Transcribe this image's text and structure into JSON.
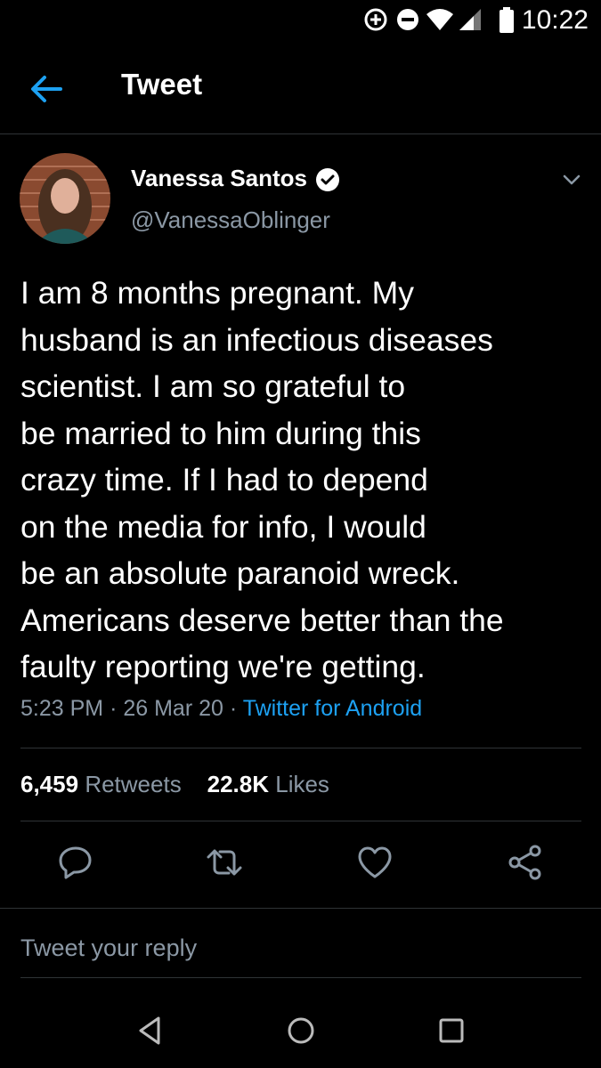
{
  "status_bar": {
    "time": "10:22",
    "icons": [
      "data-saver-icon",
      "do-not-disturb-icon",
      "wifi-icon",
      "signal-icon",
      "battery-icon"
    ]
  },
  "header": {
    "title": "Tweet",
    "back_icon": "arrow-left-icon"
  },
  "tweet": {
    "author_name": "Vanessa Santos",
    "handle": "@VanessaOblinger",
    "verified": true,
    "text": "I am 8 months pregnant. My\nhusband is an infectious diseases\nscientist. I am so grateful to\nbe married to him during this\ncrazy time. If I had to depend\non the media for info, I would\nbe an absolute paranoid wreck.\nAmericans deserve better than the\nfaulty reporting we're getting.",
    "time": "5:23 PM",
    "date": "26 Mar 20",
    "separator": "·",
    "source": "Twitter for Android",
    "retweets_count": "6,459",
    "retweets_label": "Retweets",
    "likes_count": "22.8K",
    "likes_label": "Likes"
  },
  "actions": [
    "reply-icon",
    "retweet-icon",
    "like-icon",
    "share-icon"
  ],
  "reply": {
    "placeholder": "Tweet your reply"
  },
  "colors": {
    "background": "#000000",
    "accent": "#1da1f2",
    "secondary_text": "#8b98a5",
    "divider": "#2f3336"
  }
}
